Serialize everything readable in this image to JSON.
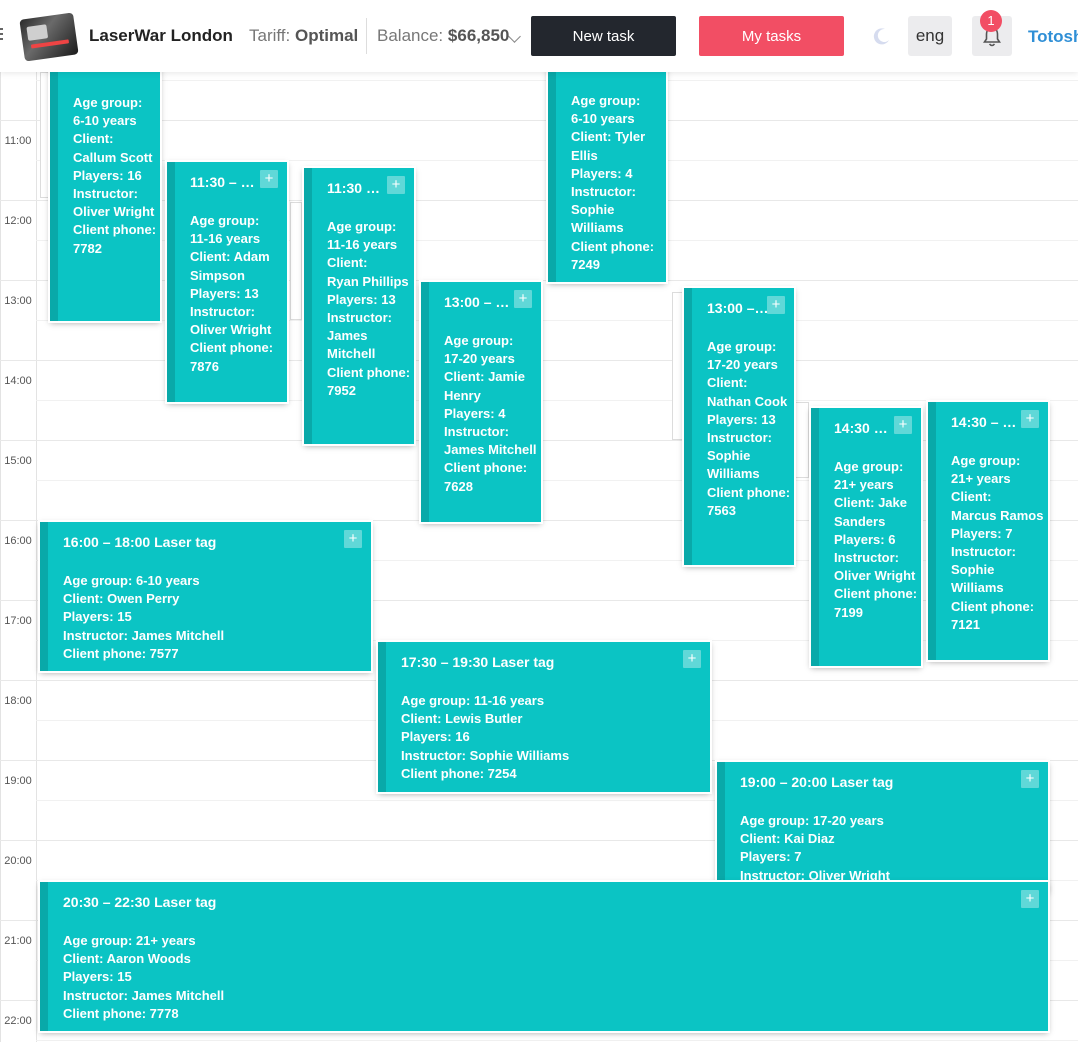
{
  "header": {
    "club_name": "LaserWar London",
    "tariff_label": "Tariff:",
    "tariff_value": "Optimal",
    "balance_label": "Balance:",
    "balance_value": "$66,850",
    "new_task": "New task",
    "my_tasks": "My tasks",
    "language": "eng",
    "notifications": "1",
    "user": "Totosh",
    "colors": {
      "dark_button": "#23272e",
      "accent_button": "#f24e64",
      "user_link": "#2f8fd6"
    }
  },
  "times": [
    "11:00",
    "12:00",
    "13:00",
    "14:00",
    "15:00",
    "16:00",
    "17:00",
    "18:00",
    "19:00",
    "20:00",
    "21:00",
    "22:00"
  ],
  "labels": {
    "age": "Age group:",
    "client": "Client:",
    "players": "Players:",
    "instructor": "Instructor:",
    "phone": "Client phone:"
  },
  "events": [
    {
      "title": "",
      "age": "6-10 years",
      "client": "Callum Scott",
      "players": "16",
      "instructor": "Oliver Wright",
      "phone": "7782"
    },
    {
      "title": "11:30 – 1...",
      "age": "11-16 years",
      "client": "Adam Simpson",
      "players": "13",
      "instructor": "Oliver Wright",
      "phone": "7876"
    },
    {
      "title": "11:30 – ...",
      "age": "11-16 years",
      "client": "Ryan Phillips",
      "players": "13",
      "instructor": "James Mitchell",
      "phone": "7952"
    },
    {
      "title": "13:00 – 1...",
      "age": "17-20 years",
      "client": "Jamie Henry",
      "players": "4",
      "instructor": "James Mitchell",
      "phone": "7628"
    },
    {
      "title": "",
      "age": "6-10 years",
      "client": "Tyler Ellis",
      "players": "4",
      "instructor": "Sophie Williams",
      "phone": "7249"
    },
    {
      "title": "13:00 – ...",
      "age": "17-20 years",
      "client": "Nathan Cook",
      "players": "13",
      "instructor": "Sophie Williams",
      "phone": "7563"
    },
    {
      "title": "14:30 – ...",
      "age": "21+ years",
      "client": "Jake Sanders",
      "players": "6",
      "instructor": "Oliver Wright",
      "phone": "7199"
    },
    {
      "title": "14:30 – 1...",
      "age": "21+ years",
      "client": "Marcus Ramos",
      "players": "7",
      "instructor": "Sophie Williams",
      "phone": "7121"
    },
    {
      "title": "16:00 – 18:00 Laser tag",
      "age": "6-10 years",
      "client": "Owen Perry",
      "players": "15",
      "instructor": "James Mitchell",
      "phone": "7577"
    },
    {
      "title": "17:30 – 19:30 Laser tag",
      "age": "11-16 years",
      "client": "Lewis Butler",
      "players": "16",
      "instructor": "Sophie Williams",
      "phone": "7254"
    },
    {
      "title": "19:00 – 20:00 Laser tag",
      "age": "17-20 years",
      "client": "Kai Diaz",
      "players": "7",
      "instructor": "Oliver Wright",
      "phone": ""
    },
    {
      "title": "20:30 – 22:30 Laser tag",
      "age": "21+ years",
      "client": "Aaron Woods",
      "players": "15",
      "instructor": "James Mitchell",
      "phone": "7778"
    }
  ],
  "plus_symbol": "+"
}
